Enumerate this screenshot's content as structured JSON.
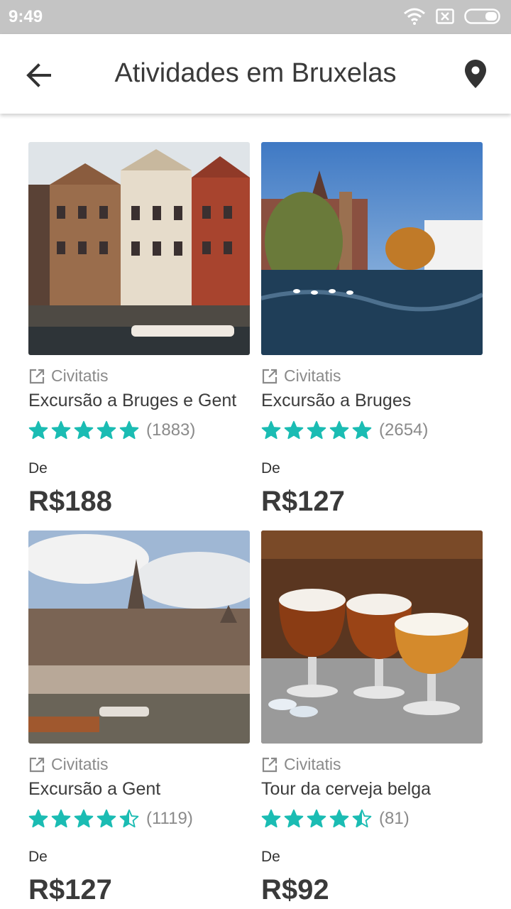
{
  "status_bar": {
    "time": "9:49"
  },
  "app_bar": {
    "title": "Atividades em Bruxelas",
    "back_icon": "arrow-left-icon",
    "location_icon": "map-pin-icon"
  },
  "colors": {
    "star": "#1bbcb3",
    "title_text": "#3a3a3a",
    "muted_text": "#8a8a8a"
  },
  "cards": [
    {
      "provider": "Civitatis",
      "title": "Excursão a Bruges e Gent",
      "rating": 5,
      "reviews": "(1883)",
      "from_label": "De",
      "price": "R$188"
    },
    {
      "provider": "Civitatis",
      "title": "Excursão a Bruges",
      "rating": 5,
      "reviews": "(2654)",
      "from_label": "De",
      "price": "R$127"
    },
    {
      "provider": "Civitatis",
      "title": "Excursão a Gent",
      "rating": 4.5,
      "reviews": "(1119)",
      "from_label": "De",
      "price": "R$127"
    },
    {
      "provider": "Civitatis",
      "title": "Tour da cerveja belga",
      "rating": 4.5,
      "reviews": "(81)",
      "from_label": "De",
      "price": "R$92"
    }
  ]
}
